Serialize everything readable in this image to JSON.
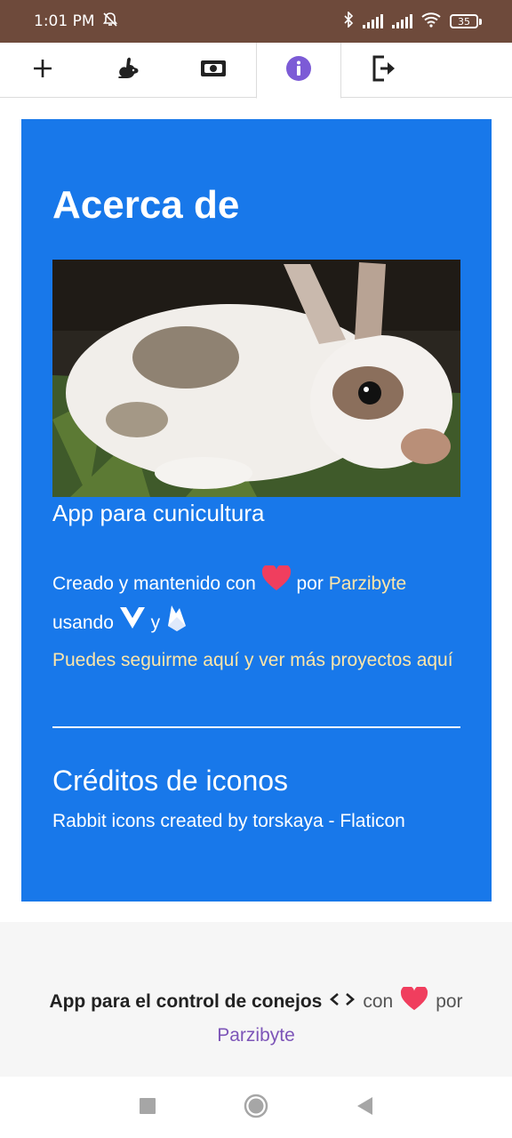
{
  "status_bar": {
    "time": "1:01 PM",
    "battery": "35",
    "icons": [
      "silent-bell-icon",
      "bluetooth-icon",
      "signal-icon",
      "signal-icon",
      "wifi-icon",
      "battery-icon"
    ]
  },
  "top_nav": {
    "tabs": [
      {
        "icon": "plus-icon",
        "active": false
      },
      {
        "icon": "rabbit-icon",
        "active": false
      },
      {
        "icon": "money-icon",
        "active": false
      },
      {
        "icon": "info-icon",
        "active": true
      },
      {
        "icon": "logout-icon",
        "active": false
      }
    ]
  },
  "about": {
    "title": "Acerca de",
    "image_alt": "rabbit photo",
    "subtitle": "App para cunicultura",
    "created_prefix": "Creado y mantenido con",
    "created_por": "por",
    "author": "Parzibyte",
    "using": "usando",
    "and": "y",
    "follow_link": "Puedes seguirme aquí y ver más proyectos aquí",
    "credits_title": "Créditos de iconos",
    "credits_text": "Rabbit icons created by torskaya - Flaticon"
  },
  "footer": {
    "app_text": "App para el control de conejos",
    "con": "con",
    "por": "por",
    "author": "Parzibyte"
  },
  "colors": {
    "status_bar": "#6e4a3b",
    "card": "#1878ea",
    "link": "#fde6a9",
    "heart": "#f03e5e",
    "info_active": "#7c5bd6",
    "footer_link": "#7d55b8"
  },
  "system_nav": [
    "square-icon",
    "circle-home-icon",
    "back-triangle-icon"
  ]
}
